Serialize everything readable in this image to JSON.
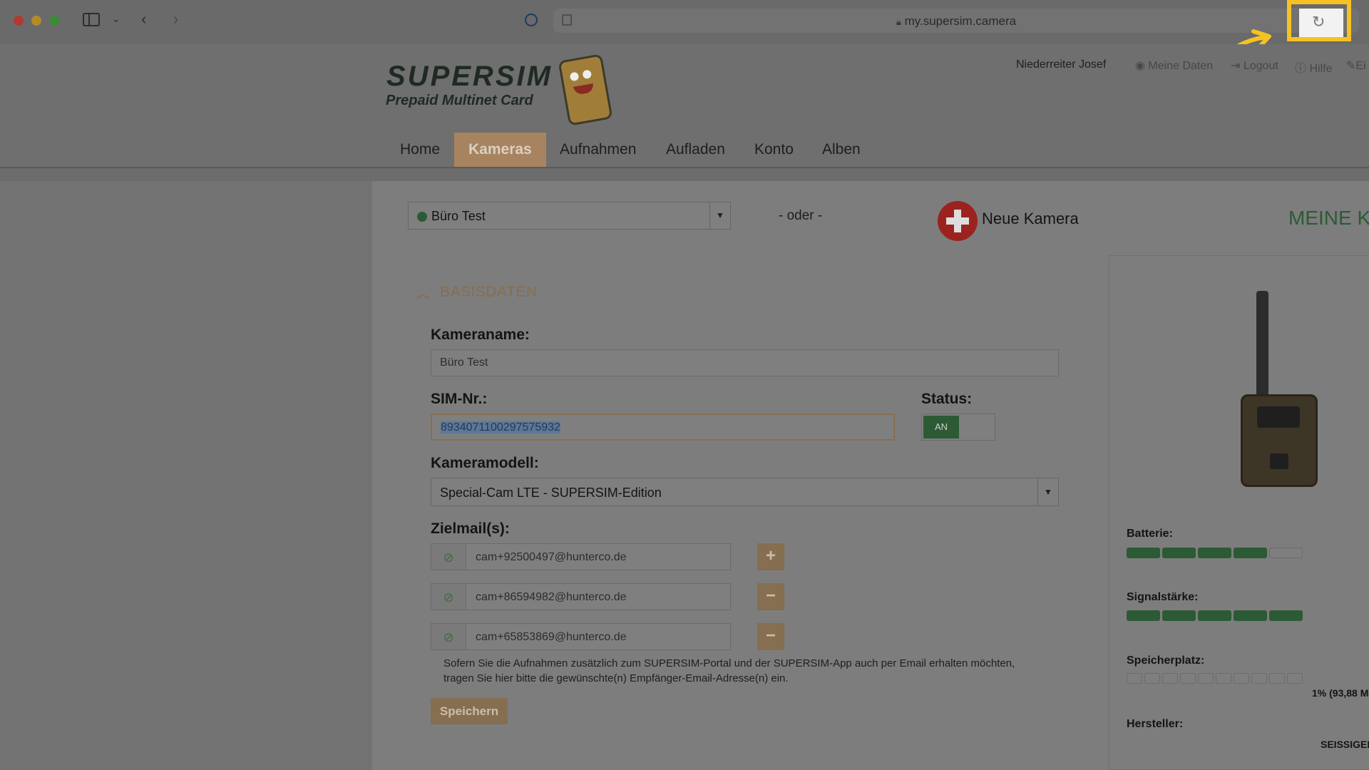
{
  "browser": {
    "url": "my.supersim.camera"
  },
  "header": {
    "logo_title": "SUPERSIM",
    "logo_subtitle": "Prepaid Multinet Card",
    "user_name": "Niederreiter Josef",
    "links": [
      {
        "label": "Meine Daten",
        "icon": "user-icon"
      },
      {
        "label": "Logout",
        "icon": "logout-icon"
      },
      {
        "label": "Hilfe",
        "icon": "help-icon"
      },
      {
        "label": "Ei",
        "icon": "wrench-icon"
      }
    ]
  },
  "nav": {
    "items": [
      "Home",
      "Kameras",
      "Aufnahmen",
      "Aufladen",
      "Konto",
      "Alben"
    ],
    "active": "Kameras"
  },
  "camera_bar": {
    "selected_camera": "Büro Test",
    "or_text": "- oder -",
    "new_camera_label": "Neue Kamera",
    "section_heading": "MEINE K"
  },
  "form": {
    "section_title": "BASISDATEN",
    "camera_name_label": "Kameraname:",
    "camera_name_value": "Büro Test",
    "sim_label": "SIM-Nr.:",
    "sim_value": "8934071100297575932",
    "status_label": "Status:",
    "status_value": "AN",
    "model_label": "Kameramodell:",
    "model_value": "Special-Cam LTE - SUPERSIM-Edition",
    "emails_label": "Zielmail(s):",
    "emails": [
      {
        "address": "cam+92500497@hunterco.de",
        "action": "+"
      },
      {
        "address": "cam+86594982@hunterco.de",
        "action": "−"
      },
      {
        "address": "cam+65853869@hunterco.de",
        "action": "−"
      }
    ],
    "hint_line1": "Sofern Sie die Aufnahmen zusätzlich zum SUPERSIM-Portal und der SUPERSIM-App auch per Email erhalten möchten,",
    "hint_line2": "tragen Sie hier bitte die gewünschte(n) Empfänger-Email-Adresse(n) ein.",
    "save_label": "Speichern"
  },
  "side": {
    "battery_label": "Batterie:",
    "battery_level": 4,
    "battery_max": 5,
    "signal_label": "Signalstärke:",
    "signal_level": 5,
    "signal_max": 5,
    "storage_label": "Speicherplatz:",
    "storage_segments": 10,
    "storage_text": "1% (93,88 M",
    "manufacturer_label": "Hersteller:",
    "manufacturer_value": "SEISSIGEI"
  },
  "colors": {
    "accent": "#a7845f",
    "status_on": "#2c5a34",
    "highlight": "#f6c223"
  }
}
